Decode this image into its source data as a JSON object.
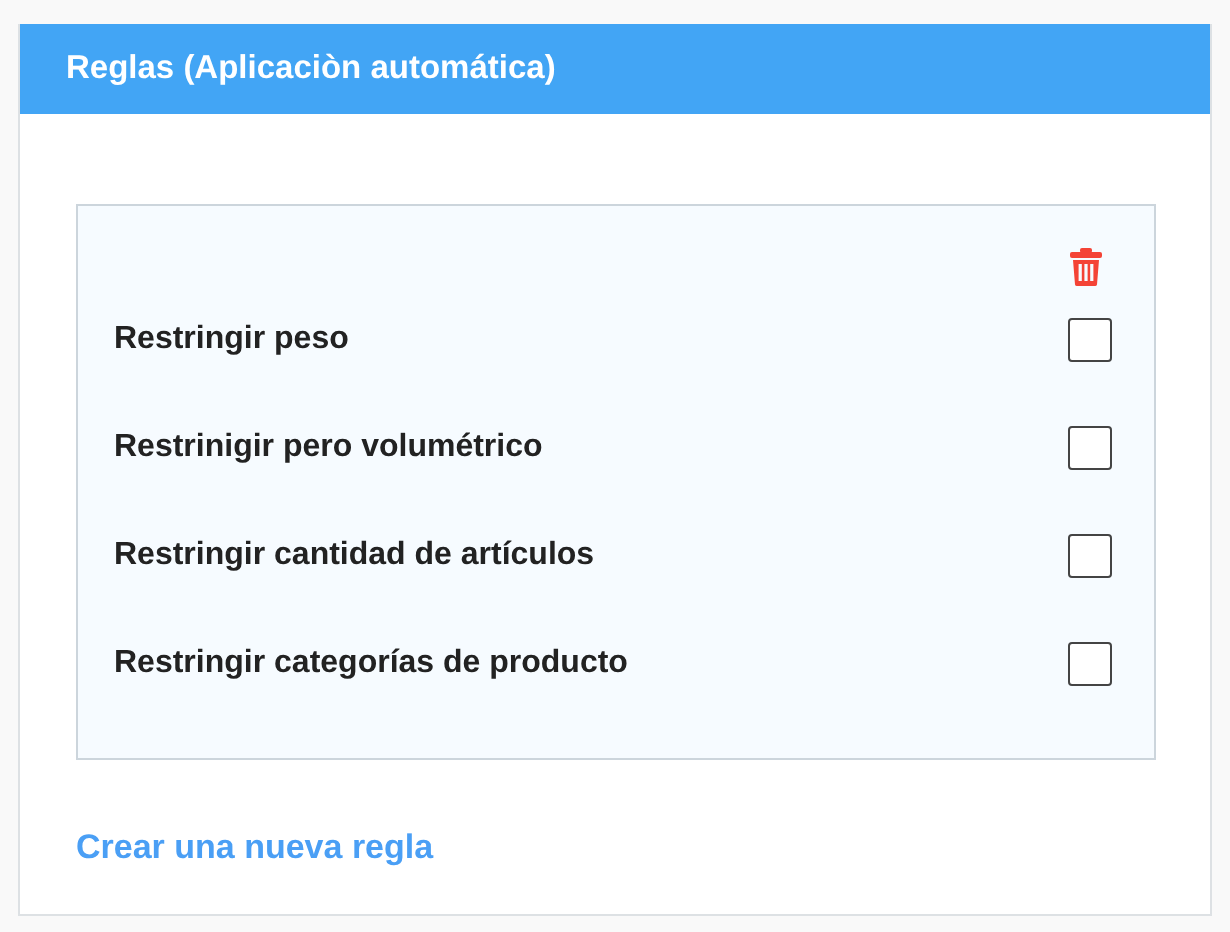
{
  "panel": {
    "title": "Reglas (Aplicaciòn automática)"
  },
  "rules": [
    {
      "label": "Restringir peso",
      "checked": false
    },
    {
      "label": "Restrinigir pero volumétrico",
      "checked": false
    },
    {
      "label": "Restringir cantidad de artículos",
      "checked": false
    },
    {
      "label": "Restringir categorías de producto",
      "checked": false
    }
  ],
  "link": "Crear una nueva regla"
}
